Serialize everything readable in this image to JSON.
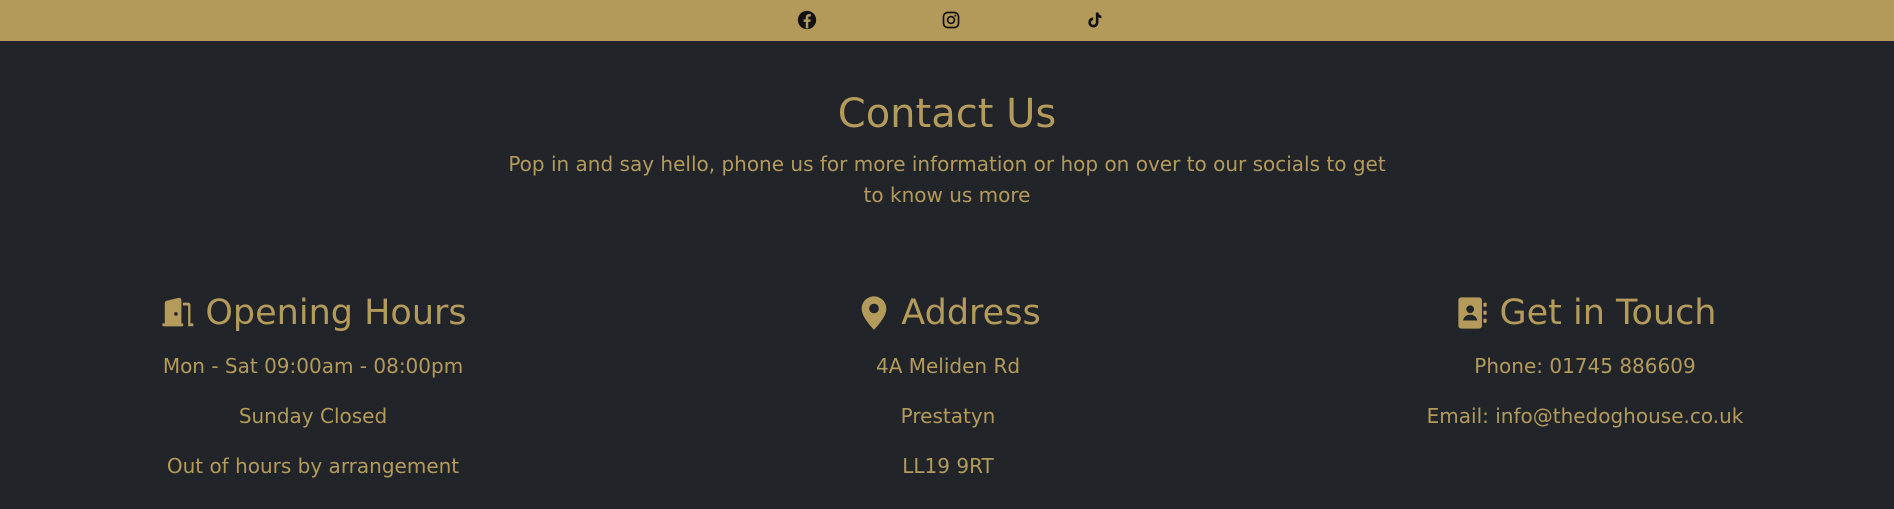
{
  "colors": {
    "page_background": "#212428",
    "accent_gold": "#b39a5b",
    "text_gold": "#b59b5b",
    "social_icon": "#111111"
  },
  "social_bar": {
    "links": [
      {
        "name": "Facebook",
        "icon": "facebook-icon"
      },
      {
        "name": "Instagram",
        "icon": "instagram-icon"
      },
      {
        "name": "TikTok",
        "icon": "tiktok-icon"
      }
    ]
  },
  "contact": {
    "title": "Contact Us",
    "intro": "Pop in and say hello, phone us for more information or hop on over to our socials to get to know us more",
    "columns": {
      "hours": {
        "icon": "door-open-icon",
        "heading": "Opening Hours",
        "lines": [
          "Mon - Sat 09:00am - 08:00pm",
          "Sunday Closed",
          "Out of hours by arrangement"
        ]
      },
      "address": {
        "icon": "map-pin-icon",
        "heading": "Address",
        "lines": [
          "4A Meliden Rd",
          "Prestatyn",
          "LL19 9RT"
        ]
      },
      "touch": {
        "icon": "address-book-icon",
        "heading": "Get in Touch",
        "lines": [
          "Phone: 01745 886609",
          "Email: info@thedoghouse.co.uk"
        ]
      }
    }
  }
}
